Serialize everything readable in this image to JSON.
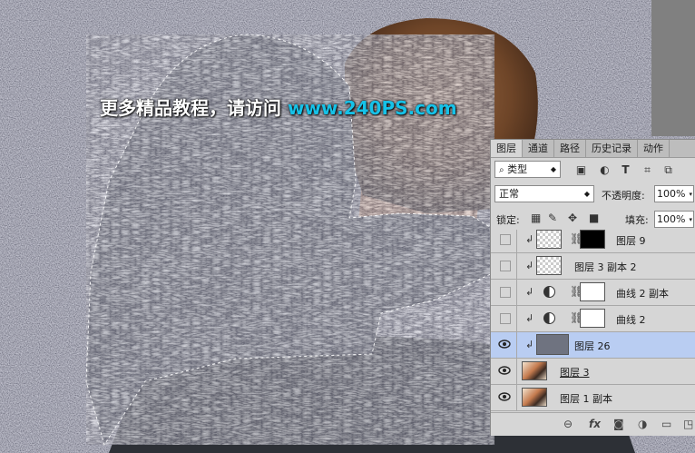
{
  "watermark": {
    "text": "更多精品教程，请访问",
    "url": "www.240PS.com"
  },
  "layers_panel": {
    "tabs": [
      {
        "label": "图层",
        "active": true
      },
      {
        "label": "通道",
        "active": false
      },
      {
        "label": "路径",
        "active": false
      },
      {
        "label": "历史记录",
        "active": false
      },
      {
        "label": "动作",
        "active": false
      }
    ],
    "filter": {
      "kind_label": "类型",
      "icons": [
        "image-filter-icon",
        "adjustment-filter-icon",
        "type-filter-icon",
        "shape-filter-icon",
        "smart-object-filter-icon"
      ]
    },
    "blend_mode": "正常",
    "opacity_label": "不透明度:",
    "opacity_value": "100%",
    "lock_label": "锁定:",
    "fill_label": "填充:",
    "fill_value": "100%",
    "layers": [
      {
        "name": "图层 9",
        "visible": false,
        "clipped": true,
        "selected": false
      },
      {
        "name": "图层 3 副本 2",
        "visible": false,
        "clipped": true,
        "selected": false
      },
      {
        "name": "曲线 2 副本",
        "visible": false,
        "clipped": true,
        "selected": false
      },
      {
        "name": "曲线 2",
        "visible": false,
        "clipped": true,
        "selected": false
      },
      {
        "name": "图层 26",
        "visible": true,
        "clipped": true,
        "selected": true
      },
      {
        "name": "图层 3",
        "visible": true,
        "clipped": false,
        "selected": false
      },
      {
        "name": "图层 1 副本",
        "visible": true,
        "clipped": false,
        "selected": false
      }
    ],
    "footer_icons": [
      "link-layers-icon",
      "fx-icon",
      "add-mask-icon",
      "new-adjustment-icon",
      "new-group-icon",
      "new-layer-icon"
    ]
  }
}
